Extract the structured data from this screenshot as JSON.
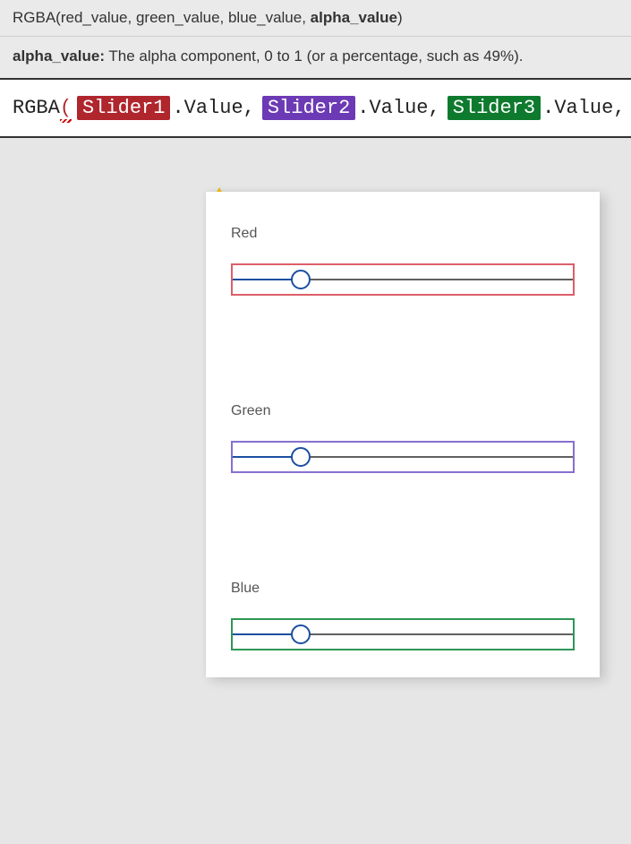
{
  "intellisense": {
    "signature_prefix": "RGBA(",
    "signature_params_plain": "red_value, green_value, blue_value, ",
    "signature_param_bold": "alpha_value",
    "signature_suffix": ")",
    "desc_label": "alpha_value:",
    "desc_text": " The alpha component, 0 to 1 (or a percentage, such as 49%)."
  },
  "formula": {
    "function_name": "RGBA",
    "open_paren": "(",
    "slider1_token": "Slider1",
    "slider2_token": "Slider2",
    "slider3_token": "Slider3",
    "dot": ".",
    "property": "Value",
    "comma": ","
  },
  "sliders": [
    {
      "label": "Red",
      "border_class": "red-b",
      "value_percent": 20
    },
    {
      "label": "Green",
      "border_class": "purple-b",
      "value_percent": 20
    },
    {
      "label": "Blue",
      "border_class": "green-b",
      "value_percent": 20
    }
  ],
  "icons": {
    "warning": "warning-triangle"
  }
}
